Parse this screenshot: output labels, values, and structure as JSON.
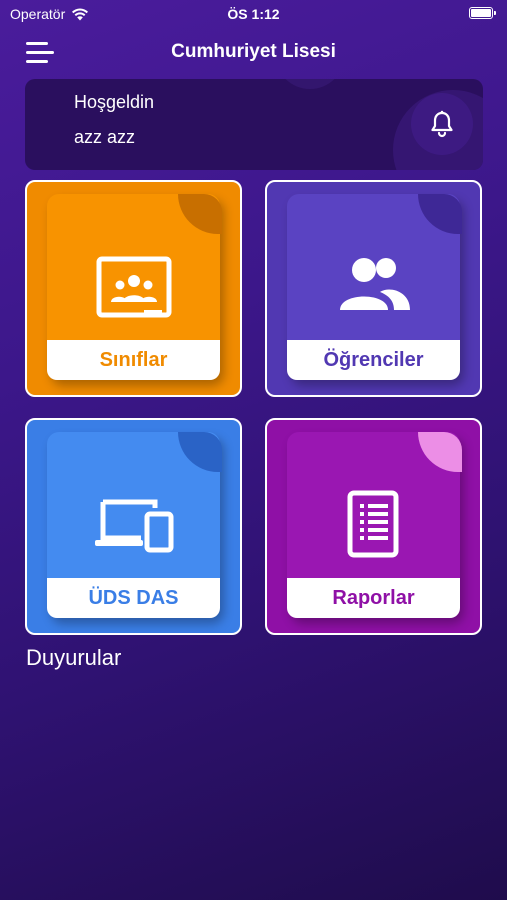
{
  "status_bar": {
    "carrier": "Operatör",
    "time": "ÖS 1:12"
  },
  "header": {
    "title": "Cumhuriyet Lisesi",
    "menu_icon": "hamburger-menu-icon"
  },
  "welcome": {
    "greeting": "Hoşgeldin",
    "user": "azz azz",
    "bell_icon": "bell-icon"
  },
  "tiles": [
    {
      "label": "Sınıflar",
      "icon": "classroom-board-icon",
      "color": "#f08b00"
    },
    {
      "label": "Öğrenciler",
      "icon": "users-icon",
      "color": "#5138b2"
    },
    {
      "label": "ÜDS DAS",
      "icon": "devices-icon",
      "color": "#3a7ee6"
    },
    {
      "label": "Raporlar",
      "icon": "report-document-icon",
      "color": "#8f10a6"
    }
  ],
  "section": {
    "announcements_title": "Duyurular"
  },
  "colors": {
    "background": "#3c178a",
    "welcome_card": "#2a0f5e"
  }
}
